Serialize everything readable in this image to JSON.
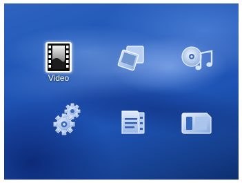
{
  "menu": {
    "items": [
      {
        "id": "video",
        "label": "Video",
        "icon": "film-strip-icon",
        "selected": true
      },
      {
        "id": "photo",
        "label": "",
        "icon": "photos-icon",
        "selected": false
      },
      {
        "id": "music",
        "label": "",
        "icon": "music-disc-icon",
        "selected": false
      },
      {
        "id": "settings",
        "label": "",
        "icon": "gears-icon",
        "selected": false
      },
      {
        "id": "files",
        "label": "",
        "icon": "file-manager-icon",
        "selected": false
      },
      {
        "id": "card",
        "label": "",
        "icon": "memory-card-icon",
        "selected": false
      }
    ]
  },
  "colors": {
    "background": "#1f56b6",
    "icon_fill": "#c8dcf5",
    "selected_icon": "#ffffff",
    "label": "#ffffff"
  }
}
